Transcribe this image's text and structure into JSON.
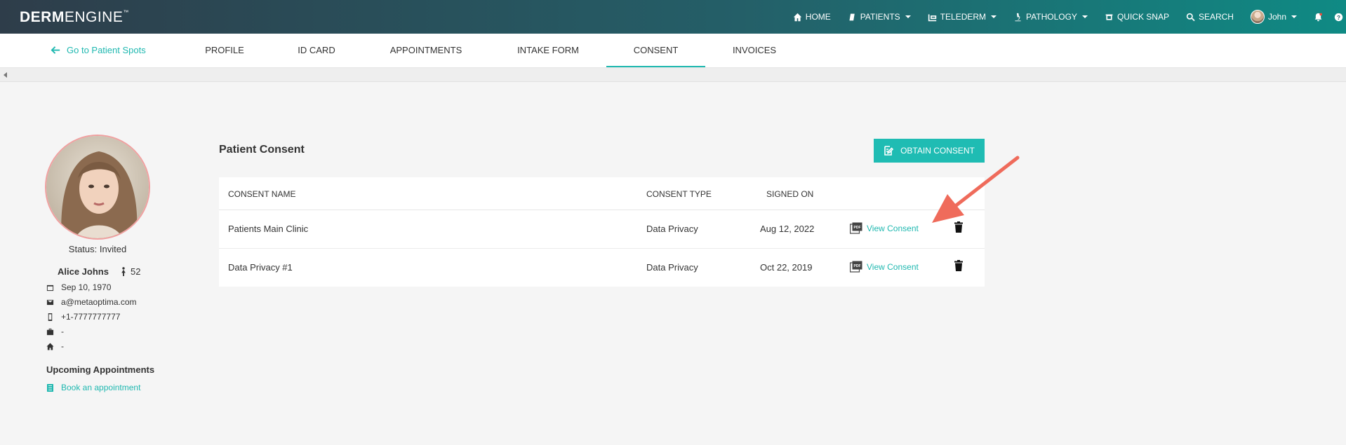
{
  "brand": {
    "logo_bold": "DERM",
    "logo_light": "ENGINE",
    "logo_tm": "™"
  },
  "topnav": {
    "items": [
      {
        "label": "HOME",
        "icon": "home-icon",
        "dropdown": false
      },
      {
        "label": "PATIENTS",
        "icon": "patients-icon",
        "dropdown": true
      },
      {
        "label": "TELEDERM",
        "icon": "telederm-icon",
        "dropdown": true
      },
      {
        "label": "PATHOLOGY",
        "icon": "microscope-icon",
        "dropdown": true
      },
      {
        "label": "QUICK SNAP",
        "icon": "camera-icon",
        "dropdown": false
      },
      {
        "label": "SEARCH",
        "icon": "search-icon",
        "dropdown": false
      }
    ],
    "user": "John",
    "notifications_icon": "bell-icon",
    "help_icon": "help-icon"
  },
  "tabs": {
    "back_label": "Go to Patient Spots",
    "items": [
      "PROFILE",
      "ID CARD",
      "APPOINTMENTS",
      "INTAKE FORM",
      "CONSENT",
      "INVOICES"
    ],
    "active": "CONSENT"
  },
  "patient": {
    "status": "Status: Invited",
    "name": "Alice Johns",
    "age": "52",
    "dob": "Sep 10, 1970",
    "email": "a@metaoptima.com",
    "phone": "+1-7777777777",
    "work": "-",
    "home": "-",
    "upcoming_title": "Upcoming Appointments",
    "book_label": "Book an appointment"
  },
  "consent": {
    "title": "Patient Consent",
    "obtain_button": "OBTAIN CONSENT",
    "columns": {
      "name": "CONSENT NAME",
      "type": "CONSENT TYPE",
      "signed": "SIGNED ON"
    },
    "rows": [
      {
        "name": "Patients Main Clinic",
        "type": "Data Privacy",
        "signed": "Aug 12, 2022",
        "view": "View Consent"
      },
      {
        "name": "Data Privacy #1",
        "type": "Data Privacy",
        "signed": "Oct 22, 2019",
        "view": "View Consent"
      }
    ]
  },
  "colors": {
    "accent": "#1fbcb3",
    "annotation_arrow": "#ef6b5b"
  }
}
